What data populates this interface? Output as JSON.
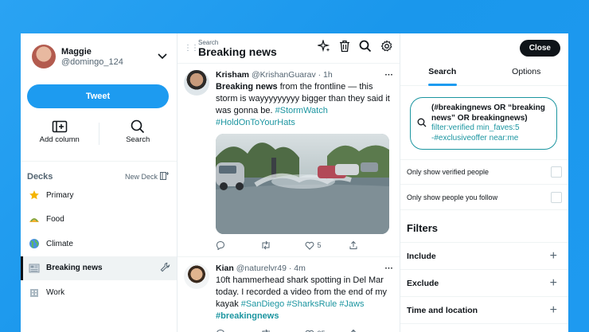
{
  "account": {
    "name": "Maggie",
    "handle": "@domingo_124"
  },
  "sidebar": {
    "tweet_label": "Tweet",
    "add_column_label": "Add column",
    "search_label": "Search",
    "decks_title": "Decks",
    "new_deck_label": "New Deck",
    "decks": [
      {
        "label": "Primary",
        "icon": "star-icon"
      },
      {
        "label": "Food",
        "icon": "taco-icon"
      },
      {
        "label": "Climate",
        "icon": "globe-icon"
      },
      {
        "label": "Breaking news",
        "icon": "newspaper-icon",
        "active": true
      },
      {
        "label": "Work",
        "icon": "building-icon"
      }
    ]
  },
  "column": {
    "subtitle": "Search",
    "title": "Breaking news",
    "tweets": [
      {
        "name": "Krisham",
        "meta": "@KrishanGuarav · 1h",
        "text_highlight": "Breaking news",
        "text_plain": " from the frontline — this storm is wayyyyyyyyy bigger than they said it was gonna be. ",
        "tags": "#StormWatch #HoldOnToYourHats",
        "likes": "5"
      },
      {
        "name": "Kian",
        "meta": "@naturelvr49 · 4m",
        "text_plain": "10ft hammerhead shark spotting in Del Mar today. I recorded a video from the end of my kayak ",
        "tags": "#SanDiego #SharksRule #Jaws",
        "tag_bold": "#breakingnews",
        "likes": "25"
      }
    ]
  },
  "panel": {
    "close_label": "Close",
    "tabs": [
      "Search",
      "Options"
    ],
    "query": {
      "bold": "(#breakingnews OR “breaking news” OR breakingnews)",
      "op1": "filter:",
      "val1": "verified ",
      "op2": "min_faves:",
      "val2": "5",
      "op3": "-#exclusiveoffer ",
      "op4": "near:",
      "val4": "me"
    },
    "options": [
      "Only show verified people",
      "Only show people you follow"
    ],
    "filters_title": "Filters",
    "filters": [
      "Include",
      "Exclude",
      "Time and location"
    ]
  },
  "colors": {
    "accent": "#1d9bf0",
    "tag": "#1b95a0"
  }
}
